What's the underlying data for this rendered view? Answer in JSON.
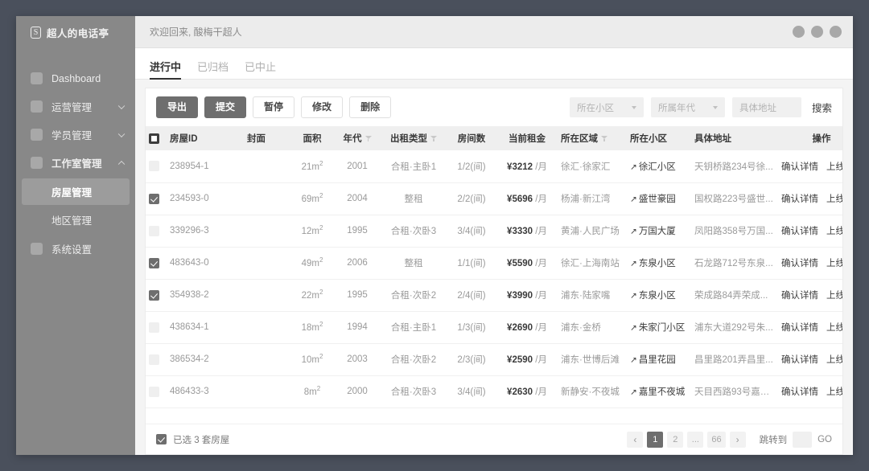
{
  "sidebar": {
    "brand": "超人的电话亭",
    "logo_icon": "app-logo-icon",
    "items": [
      {
        "label": "Dashboard",
        "icon": "square-icon",
        "expandable": false,
        "bold": false
      },
      {
        "label": "运营管理",
        "icon": "square-icon",
        "expandable": true,
        "bold": false
      },
      {
        "label": "学员管理",
        "icon": "square-icon",
        "expandable": true,
        "bold": false
      },
      {
        "label": "工作室管理",
        "icon": "square-icon",
        "expandable": true,
        "expanded": true,
        "bold": true
      }
    ],
    "sub_items": [
      {
        "label": "房屋管理",
        "active": true
      },
      {
        "label": "地区管理",
        "active": false
      }
    ],
    "tail_items": [
      {
        "label": "系统设置",
        "icon": "square-icon",
        "expandable": false,
        "bold": false
      }
    ]
  },
  "topbar": {
    "welcome": "欢迎回来, 酸梅干超人",
    "window_dots": [
      "dot-1",
      "dot-2",
      "dot-3"
    ]
  },
  "tabs": [
    {
      "label": "进行中",
      "active": true
    },
    {
      "label": "已归档",
      "active": false
    },
    {
      "label": "已中止",
      "active": false
    }
  ],
  "toolbar": {
    "buttons": [
      {
        "label": "导出",
        "primary": true
      },
      {
        "label": "提交",
        "primary": true
      },
      {
        "label": "暂停",
        "primary": false
      },
      {
        "label": "修改",
        "primary": false
      },
      {
        "label": "删除",
        "primary": false
      }
    ],
    "filters": {
      "community_placeholder": "所在小区",
      "era_placeholder": "所属年代",
      "address_placeholder": "具体地址",
      "search_label": "搜索"
    }
  },
  "table": {
    "columns": [
      {
        "key": "chk",
        "label": "",
        "filter": false
      },
      {
        "key": "id",
        "label": "房屋ID",
        "filter": false
      },
      {
        "key": "cover",
        "label": "封面",
        "filter": false
      },
      {
        "key": "area",
        "label": "面积",
        "filter": false
      },
      {
        "key": "year",
        "label": "年代",
        "filter": true
      },
      {
        "key": "type",
        "label": "出租类型",
        "filter": true
      },
      {
        "key": "rooms",
        "label": "房间数",
        "filter": false
      },
      {
        "key": "rent",
        "label": "当前租金",
        "filter": false
      },
      {
        "key": "region",
        "label": "所在区域",
        "filter": true
      },
      {
        "key": "comm",
        "label": "所在小区",
        "filter": false
      },
      {
        "key": "addr",
        "label": "具体地址",
        "filter": false
      },
      {
        "key": "ops",
        "label": "操作",
        "filter": false
      }
    ],
    "header_checkbox": "indeterminate",
    "ops_labels": [
      "确认详情",
      "上线房屋"
    ],
    "rent_unit": "/月",
    "rows": [
      {
        "checked": false,
        "id": "238954-1",
        "area": "21",
        "year": "2001",
        "type": "合租·主卧1",
        "rooms": "1/2(间)",
        "rent": "¥3212",
        "region": "徐汇·徐家汇",
        "comm": "徐汇小区",
        "addr": "天钥桥路234号徐..."
      },
      {
        "checked": true,
        "id": "234593-0",
        "area": "69",
        "year": "2004",
        "type": "整租",
        "rooms": "2/2(间)",
        "rent": "¥5696",
        "region": "杨浦·新江湾",
        "comm": "盛世豪园",
        "addr": "国权路223号盛世..."
      },
      {
        "checked": false,
        "id": "339296-3",
        "area": "12",
        "year": "1995",
        "type": "合租·次卧3",
        "rooms": "3/4(间)",
        "rent": "¥3330",
        "region": "黄浦·人民广场",
        "comm": "万国大厦",
        "addr": "凤阳路358号万国..."
      },
      {
        "checked": true,
        "id": "483643-0",
        "area": "49",
        "year": "2006",
        "type": "整租",
        "rooms": "1/1(间)",
        "rent": "¥5590",
        "region": "徐汇·上海南站",
        "comm": "东泉小区",
        "addr": "石龙路712号东泉..."
      },
      {
        "checked": true,
        "id": "354938-2",
        "area": "22",
        "year": "1995",
        "type": "合租·次卧2",
        "rooms": "2/4(间)",
        "rent": "¥3990",
        "region": "浦东·陆家嘴",
        "comm": "东泉小区",
        "addr": "荣成路84弄荣成..."
      },
      {
        "checked": false,
        "id": "438634-1",
        "area": "18",
        "year": "1994",
        "type": "合租·主卧1",
        "rooms": "1/3(间)",
        "rent": "¥2690",
        "region": "浦东·金桥",
        "comm": "朱家门小区",
        "addr": "浦东大道292号朱..."
      },
      {
        "checked": false,
        "id": "386534-2",
        "area": "10",
        "year": "2003",
        "type": "合租·次卧2",
        "rooms": "2/3(间)",
        "rent": "¥2590",
        "region": "浦东·世博后滩",
        "comm": "昌里花园",
        "addr": "昌里路201弄昌里..."
      },
      {
        "checked": false,
        "id": "486433-3",
        "area": "8",
        "year": "2000",
        "type": "合租·次卧3",
        "rooms": "3/4(间)",
        "rent": "¥2630",
        "region": "新静安·不夜城",
        "comm": "嘉里不夜城",
        "addr": "天目西路93号嘉里..."
      }
    ]
  },
  "footer": {
    "selection_text": "已选 3 套房屋",
    "selection_checked": true,
    "pagination": {
      "prev_icon": "‹",
      "next_icon": "›",
      "pages": [
        {
          "label": "1",
          "active": true
        },
        {
          "label": "2",
          "active": false
        },
        {
          "label": "...",
          "active": false
        },
        {
          "label": "66",
          "active": false
        }
      ],
      "jump_label": "跳转到",
      "jump_value": "",
      "go_label": "GO"
    }
  },
  "colors": {
    "sidebar_bg": "#888888",
    "primary_button": "#6e6e6e",
    "page_bg": "#4a505c",
    "panel_bg": "#ffffff"
  }
}
